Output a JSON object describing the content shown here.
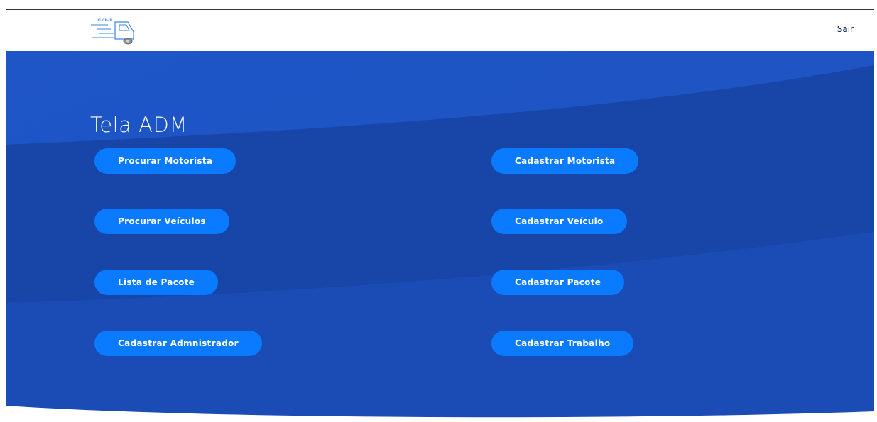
{
  "header": {
    "logo_text": "Truck-In",
    "logout_label": "Sair"
  },
  "main": {
    "title": "Tela ADM",
    "left_buttons": [
      {
        "label": "Procurar Motorista"
      },
      {
        "label": "Procurar Veículos"
      },
      {
        "label": "Lista de Pacote"
      },
      {
        "label": "Cadastrar Admnistrador"
      }
    ],
    "right_buttons": [
      {
        "label": "Cadastrar Motorista"
      },
      {
        "label": "Cadastrar Veículo"
      },
      {
        "label": "Cadastrar Pacote"
      },
      {
        "label": "Cadastrar Trabalho"
      }
    ]
  },
  "colors": {
    "hero_blue": "#1b4fbf",
    "hero_dark": "#17429f",
    "button_blue": "#0a7bff"
  },
  "icons": {
    "logo": "truck-icon"
  }
}
